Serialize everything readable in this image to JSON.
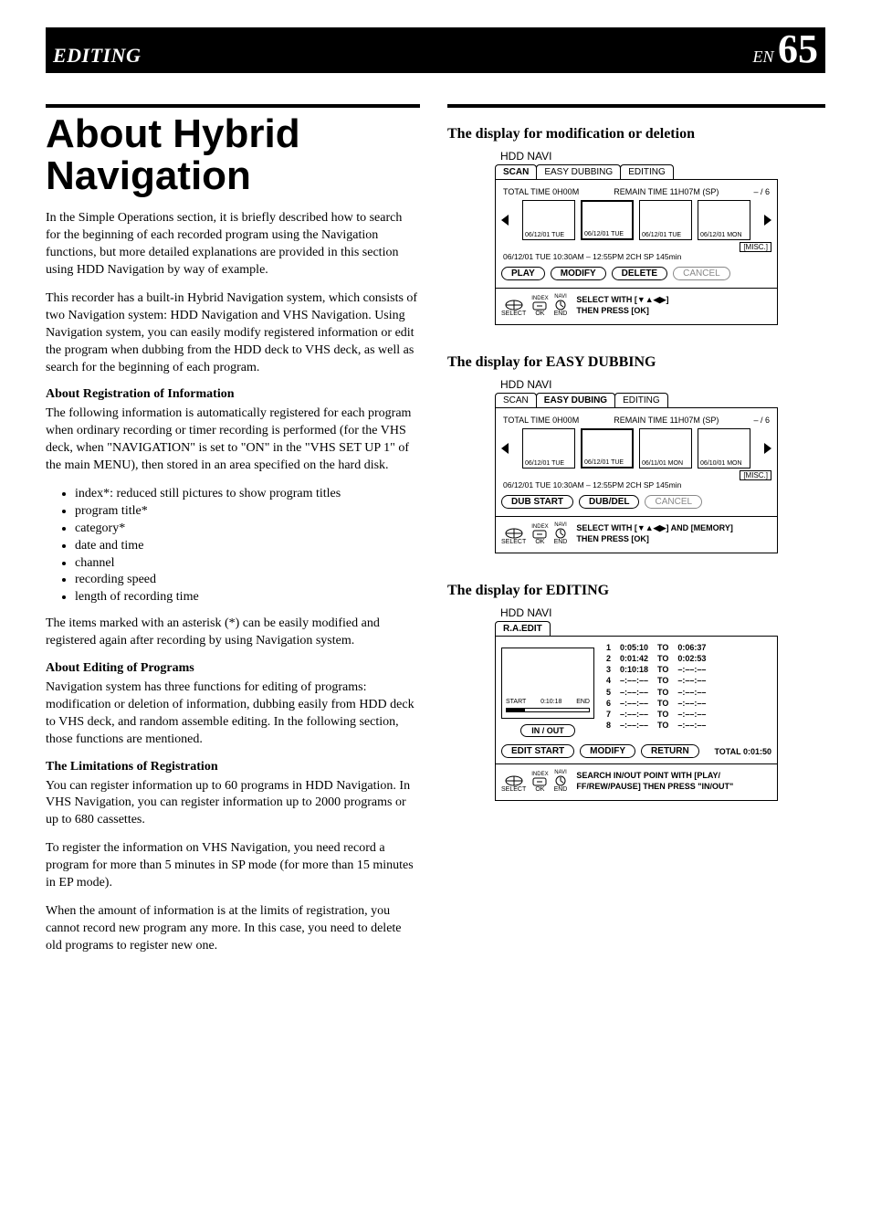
{
  "header": {
    "section": "EDITING",
    "lang": "EN",
    "page": "65"
  },
  "left": {
    "title": "About Hybrid Navigation",
    "intro1": "In the Simple Operations section, it is briefly described how to search for the beginning of each recorded program using the Navigation functions, but more detailed explanations are provided in this section using HDD Navigation by way of example.",
    "intro2": "This recorder has a built-in Hybrid Navigation system, which consists of two Navigation system: HDD Navigation and VHS Navigation. Using Navigation system, you can easily modify registered information or edit the program when dubbing from the HDD deck to VHS deck, as well as search for the beginning of each program.",
    "h_reg": "About Registration of Information",
    "reg_p": "The following information is automatically registered for each program when ordinary recording or timer recording is performed (for the VHS deck, when \"NAVIGATION\" is set to \"ON\" in the \"VHS SET UP 1\" of the main MENU), then stored in an area specified on the hard disk.",
    "bullets": [
      "index*: reduced still pictures to show program titles",
      "program title*",
      "category*",
      "date and time",
      "channel",
      "recording speed",
      "length of recording time"
    ],
    "reg_p2": "The items marked with an asterisk (*) can be easily modified and registered again after recording by using Navigation system.",
    "h_edit": "About Editing of Programs",
    "edit_p": "Navigation system has three functions for editing of programs: modification or deletion of information, dubbing easily from HDD deck to VHS deck, and random assemble editing. In the following section, those functions are mentioned.",
    "h_lim": "The Limitations of Registration",
    "lim_p1": "You can register information up to 60 programs in HDD Navigation. In VHS Navigation, you can register information up to 2000 programs or up to 680 cassettes.",
    "lim_p2": "To register the information on VHS Navigation, you need record a program for more than 5 minutes in SP mode (for more than 15 minutes in EP mode).",
    "lim_p3": "When the amount of information is at the limits of registration, you cannot record new program any more. In this case, you need to delete old programs to register new one."
  },
  "right": {
    "sec1_title": "The display for modification or deletion",
    "sec2_title": "The display for EASY DUBBING",
    "sec3_title": "The display for EDITING",
    "osd1": {
      "navi": "HDD NAVI",
      "tabs": [
        "SCAN",
        "EASY DUBBING",
        "EDITING"
      ],
      "sel_tab": 0,
      "total": "TOTAL TIME  0H00M",
      "remain": "REMAIN TIME 11H07M (SP)",
      "count": "– / 6",
      "thumbs": [
        "06/12/01 TUE",
        "06/12/01 TUE",
        "06/12/01 TUE",
        "06/12/01 MON"
      ],
      "sel_thumb": 1,
      "misc": "[MISC.]",
      "detail": "06/12/01 TUE 10:30AM – 12:55PM  2CH  SP  145min",
      "buttons": [
        "PLAY",
        "MODIFY",
        "DELETE",
        "CANCEL"
      ],
      "disabled": [
        3
      ],
      "help": "SELECT WITH  [▼▲◀▶]\nTHEN PRESS   [OK]"
    },
    "osd2": {
      "navi": "HDD NAVI",
      "tabs": [
        "SCAN",
        "EASY DUBING",
        "EDITING"
      ],
      "sel_tab": 1,
      "total": "TOTAL TIME  0H00M",
      "remain": "REMAIN TIME 11H07M (SP)",
      "count": "– / 6",
      "thumbs": [
        "06/12/01 TUE",
        "06/12/01 TUE",
        "06/11/01 MON",
        "06/10/01 MON"
      ],
      "sel_thumb": 1,
      "misc": "[MISC.]",
      "detail": "06/12/01 TUE 10:30AM – 12:55PM  2CH  SP  145min",
      "buttons": [
        "DUB START",
        "DUB/DEL",
        "CANCEL"
      ],
      "disabled": [
        2
      ],
      "help": "SELECT WITH  [▼▲◀▶] AND [MEMORY]\nTHEN PRESS   [OK]"
    },
    "osd3": {
      "navi": "HDD NAVI",
      "tab": "R.A.EDIT",
      "preview": {
        "start": "START",
        "time": "0:10:18",
        "end": "END"
      },
      "inout": "IN / OUT",
      "rows": [
        {
          "n": "1",
          "in": "0:05:10",
          "to": "TO",
          "out": "0:06:37"
        },
        {
          "n": "2",
          "in": "0:01:42",
          "to": "TO",
          "out": "0:02:53"
        },
        {
          "n": "3",
          "in": "0:10:18",
          "to": "TO",
          "out": "–:––:––"
        },
        {
          "n": "4",
          "in": "–:––:––",
          "to": "TO",
          "out": "–:––:––"
        },
        {
          "n": "5",
          "in": "–:––:––",
          "to": "TO",
          "out": "–:––:––"
        },
        {
          "n": "6",
          "in": "–:––:––",
          "to": "TO",
          "out": "–:––:––"
        },
        {
          "n": "7",
          "in": "–:––:––",
          "to": "TO",
          "out": "–:––:––"
        },
        {
          "n": "8",
          "in": "–:––:––",
          "to": "TO",
          "out": "–:––:––"
        }
      ],
      "buttons": [
        "EDIT START",
        "MODIFY",
        "RETURN"
      ],
      "total": "TOTAL 0:01:50",
      "help": "SEARCH IN/OUT POINT WITH [PLAY/\nFF/REW/PAUSE] THEN PRESS \"IN/OUT\""
    },
    "icon_labels": {
      "select": "SELECT",
      "ok": "OK",
      "end": "END",
      "index": "INDEX",
      "navi": "NAVI"
    }
  }
}
